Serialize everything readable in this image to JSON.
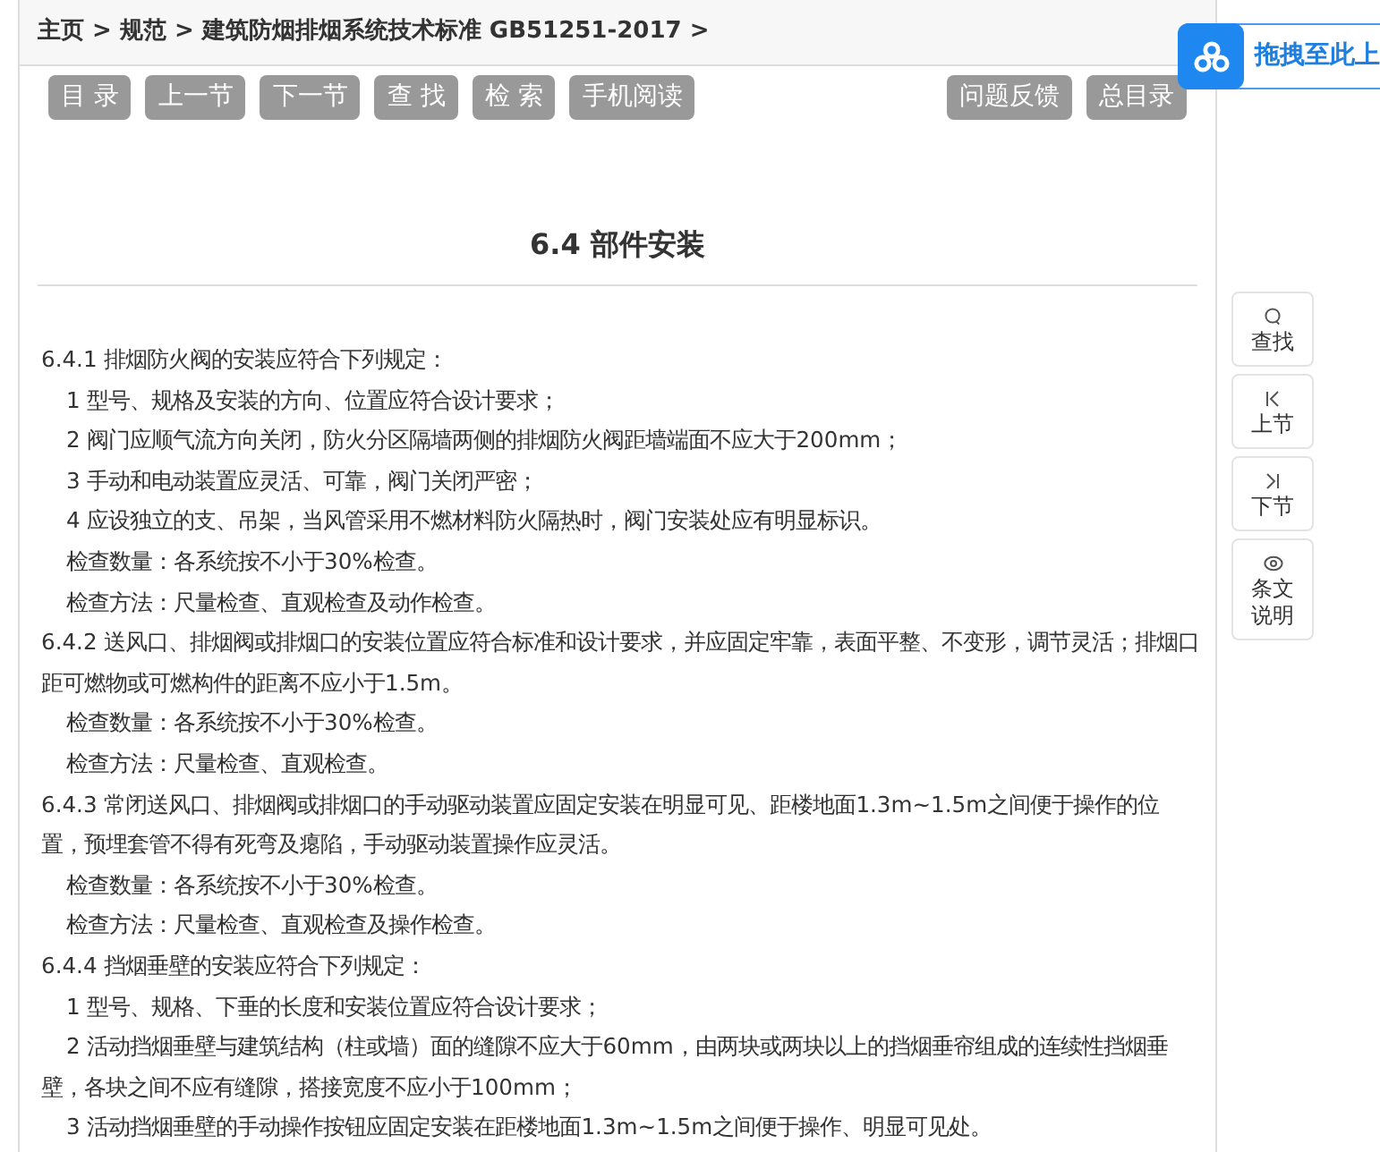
{
  "breadcrumb": "主页 > 规范 > 建筑防烟排烟系统技术标准 GB51251-2017 >",
  "toolbar_left": [
    "目 录",
    "上一节",
    "下一节",
    "查 找",
    "检 索",
    "手机阅读"
  ],
  "toolbar_right": [
    "问题反馈",
    "总目录"
  ],
  "upload_widget": {
    "label": "拖拽至此上"
  },
  "heading": "6.4 部件安装",
  "paragraphs": [
    {
      "kind": "clause",
      "text": "6.4.1 排烟防火阀的安装应符合下列规定："
    },
    {
      "kind": "item",
      "text": "1 型号、规格及安装的方向、位置应符合设计要求；"
    },
    {
      "kind": "item",
      "text": "2 阀门应顺气流方向关闭，防火分区隔墙两侧的排烟防火阀距墙端面不应大于200mm；"
    },
    {
      "kind": "item",
      "text": "3 手动和电动装置应灵活、可靠，阀门关闭严密；"
    },
    {
      "kind": "item",
      "text": "4 应设独立的支、吊架，当风管采用不燃材料防火隔热时，阀门安装处应有明显标识。"
    },
    {
      "kind": "item",
      "text": "检查数量：各系统按不小于30%检查。"
    },
    {
      "kind": "item",
      "text": "检查方法：尺量检查、直观检查及动作检查。"
    },
    {
      "kind": "clause",
      "text": "6.4.2 送风口、排烟阀或排烟口的安装位置应符合标准和设计要求，并应固定牢靠，表面平整、不变形，调节灵活；排烟口距可燃物或可燃构件的距离不应小于1.5m。"
    },
    {
      "kind": "item",
      "text": "检查数量：各系统按不小于30%检查。"
    },
    {
      "kind": "item",
      "text": "检查方法：尺量检查、直观检查。"
    },
    {
      "kind": "clause",
      "text": "6.4.3 常闭送风口、排烟阀或排烟口的手动驱动装置应固定安装在明显可见、距楼地面1.3m~1.5m之间便于操作的位置，预埋套管不得有死弯及瘪陷，手动驱动装置操作应灵活。"
    },
    {
      "kind": "item",
      "text": "检查数量：各系统按不小于30%检查。"
    },
    {
      "kind": "item",
      "text": "检查方法：尺量检查、直观检查及操作检查。"
    },
    {
      "kind": "clause",
      "text": "6.4.4 挡烟垂壁的安装应符合下列规定："
    },
    {
      "kind": "item",
      "text": "1 型号、规格、下垂的长度和安装位置应符合设计要求；"
    },
    {
      "kind": "item",
      "text": "2 活动挡烟垂壁与建筑结构（柱或墙）面的缝隙不应大于60mm，由两块或两块以上的挡烟垂帘组成的连续性挡烟垂壁，各块之间不应有缝隙，搭接宽度不应小于100mm；"
    },
    {
      "kind": "item",
      "text": "3 活动挡烟垂壁的手动操作按钮应固定安装在距楼地面1.3m~1.5m之间便于操作、明显可见处。"
    }
  ],
  "side_tools": [
    {
      "kind": "search",
      "label": "查找"
    },
    {
      "kind": "prev",
      "label": "上节"
    },
    {
      "kind": "next",
      "label": "下节"
    },
    {
      "kind": "eye",
      "label": "条文说明"
    }
  ]
}
